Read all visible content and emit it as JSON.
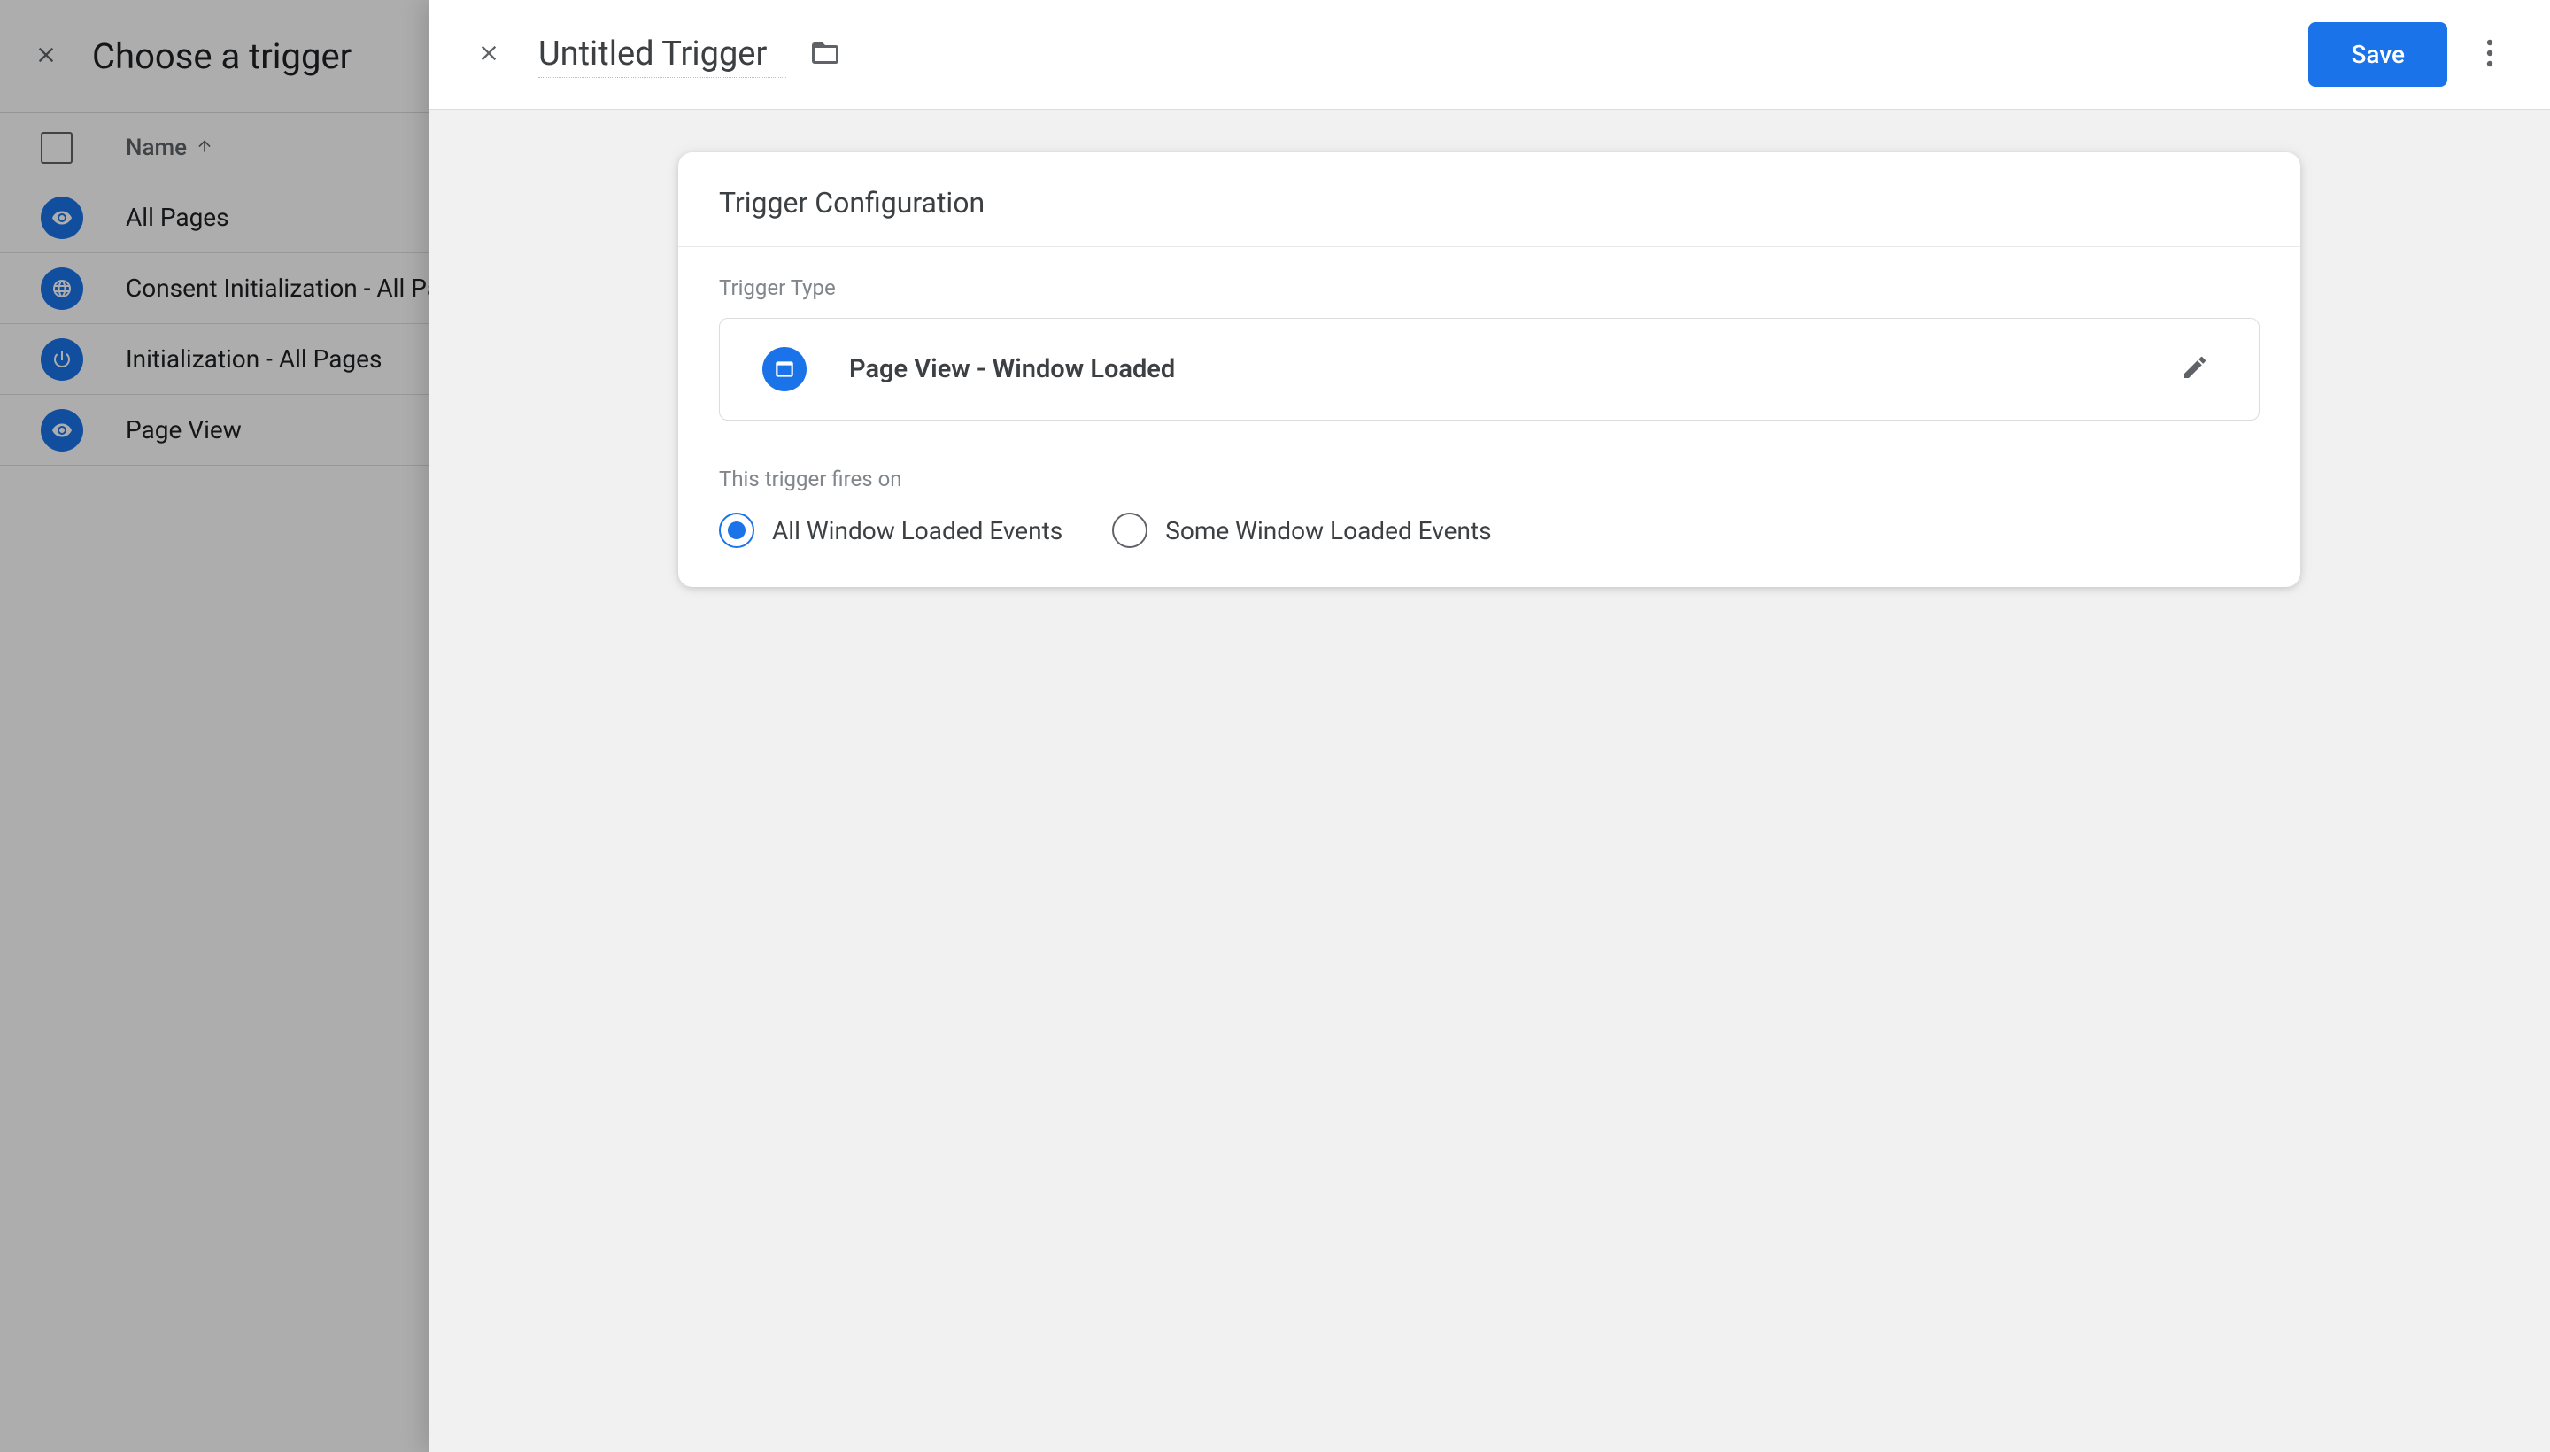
{
  "back_panel": {
    "title": "Choose a trigger",
    "column_header": "Name",
    "triggers": [
      {
        "name": "All Pages",
        "icon": "eye",
        "color": "#1a73e8"
      },
      {
        "name": "Consent Initialization - All Pages",
        "icon": "globe",
        "color": "#1a73e8"
      },
      {
        "name": "Initialization - All Pages",
        "icon": "power",
        "color": "#1a73e8"
      },
      {
        "name": "Page View",
        "icon": "eye",
        "color": "#1a73e8"
      }
    ]
  },
  "front_panel": {
    "title_value": "Untitled Trigger",
    "save_label": "Save"
  },
  "card": {
    "title": "Trigger Configuration",
    "type_label": "Trigger Type",
    "selected_type": "Page View - Window Loaded",
    "fires_label": "This trigger fires on",
    "radio_options": {
      "all": "All Window Loaded Events",
      "some": "Some Window Loaded Events"
    },
    "selected_radio": "all"
  },
  "colors": {
    "primary": "#1a73e8",
    "text": "#3c4043",
    "muted": "#80868b"
  }
}
